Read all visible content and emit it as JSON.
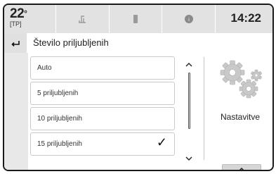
{
  "status_bar": {
    "temperature_value": "22",
    "temperature_unit": "°",
    "temperature_mode": "[TP]",
    "clock": "14:22",
    "tabs": [
      {
        "icon": "phone-icon"
      },
      {
        "icon": "phone-battery-icon"
      },
      {
        "icon": "info-circle-icon"
      }
    ]
  },
  "header": {
    "back_icon": "back-arrow-icon",
    "title": "Število priljubljenih"
  },
  "list": {
    "items": [
      {
        "label": "Auto",
        "selected": false
      },
      {
        "label": "5 priljubljenih",
        "selected": false
      },
      {
        "label": "10 priljubljenih",
        "selected": false
      },
      {
        "label": "15 priljubljenih",
        "selected": true,
        "check": "✓"
      }
    ]
  },
  "side_panel": {
    "label": "Nastavitve",
    "icon": "gears-icon"
  },
  "bottom": {
    "expand_icon": "chevron-up-icon"
  }
}
